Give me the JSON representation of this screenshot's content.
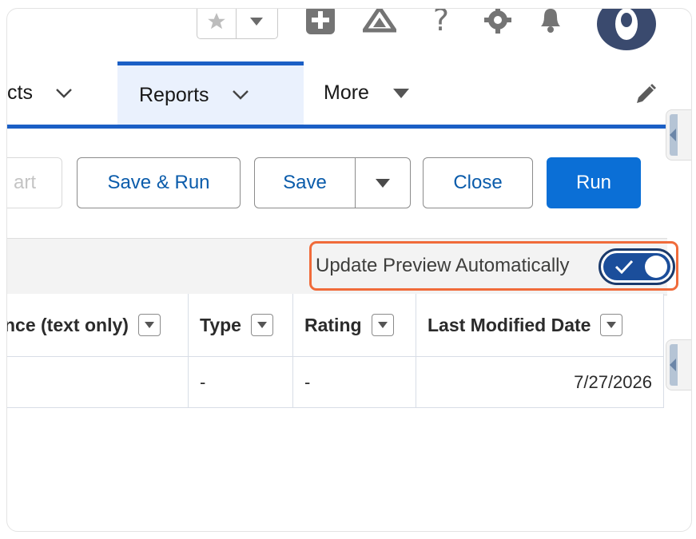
{
  "header": {
    "favorite_icon": "star-icon",
    "favorites_menu_icon": "caret-down-icon",
    "icons": [
      "add-icon",
      "trailhead-icon",
      "help-icon",
      "settings-icon",
      "notifications-bell-icon",
      "user-avatar"
    ]
  },
  "nav": {
    "tabs": [
      {
        "label": "cts",
        "active": false
      },
      {
        "label": "Reports",
        "active": true
      },
      {
        "label": "More",
        "active": false
      }
    ],
    "edit_icon": "pencil-icon"
  },
  "toolbar": {
    "chart_label": "art",
    "save_run_label": "Save & Run",
    "save_label": "Save",
    "close_label": "Close",
    "run_label": "Run"
  },
  "preview": {
    "label": "Update Preview Automatically",
    "enabled": true
  },
  "table": {
    "columns": [
      "nce (text only)",
      "Type",
      "Rating",
      "Last Modified Date"
    ],
    "rows": [
      [
        "",
        "-",
        "-",
        "7/27/2026"
      ]
    ]
  },
  "colors": {
    "brand_blue": "#0b6fd6",
    "nav_accent": "#1b5fc5",
    "highlight_orange": "#f06b3a",
    "toggle_on": "#1b4e9b"
  }
}
